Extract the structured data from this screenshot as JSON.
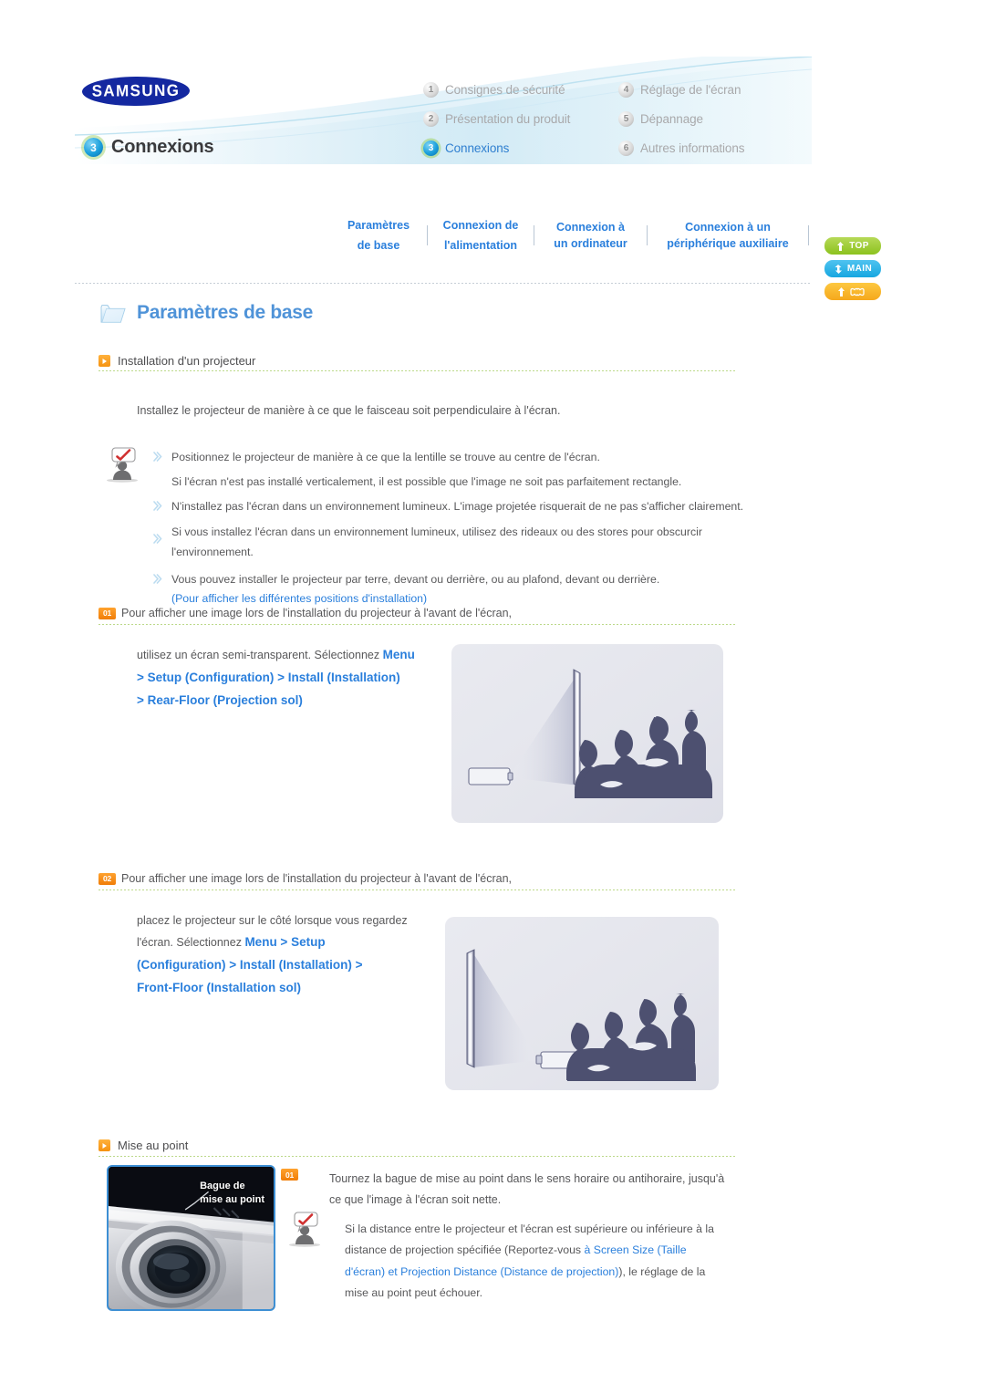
{
  "header": {
    "brand": "SAMSUNG",
    "chapter_number": "3",
    "chapter_name": "Connexions",
    "menu": [
      {
        "num": "1",
        "label": "Consignes de sécurité",
        "active": false
      },
      {
        "num": "4",
        "label": "Réglage de l'écran",
        "active": false
      },
      {
        "num": "2",
        "label": "Présentation du produit",
        "active": false
      },
      {
        "num": "5",
        "label": "Dépannage",
        "active": false
      },
      {
        "num": "3",
        "label": "Connexions",
        "active": true
      },
      {
        "num": "6",
        "label": "Autres informations",
        "active": false
      }
    ]
  },
  "tabs": [
    {
      "line1": "Paramètres",
      "line2": "de base"
    },
    {
      "line1": "Connexion de",
      "line2": "l'alimentation"
    },
    {
      "line1": "Connexion à",
      "line2": "un ordinateur"
    },
    {
      "line1": "Connexion à un",
      "line2": "périphérique auxiliaire"
    }
  ],
  "side_buttons": [
    {
      "label": "TOP",
      "icon": "arrow-up-icon",
      "color": "#8cc21e"
    },
    {
      "label": "MAIN",
      "icon": "arrow-branch-icon",
      "color": "#17a7e0"
    },
    {
      "label": "",
      "icon": "arrow-up-home-icon",
      "color": "#f5a81c"
    }
  ],
  "section": {
    "title": "Paramètres de base",
    "title_icon": "folder-icon"
  },
  "subsection_1": {
    "heading": "Installation d'un projecteur",
    "intro": "Installez le projecteur de manière à ce que le faisceau soit perpendiculaire à l'écran.",
    "tip_icon": "person-note-icon",
    "bullets": [
      {
        "bullet": true,
        "text": "Positionnez le projecteur de manière à ce que la lentille se trouve au centre de l'écran."
      },
      {
        "bullet": false,
        "text": "Si l'écran n'est pas installé verticalement, il est possible que l'image ne soit pas parfaitement rectangle."
      },
      {
        "bullet": true,
        "text": "N'installez pas l'écran dans un environnement lumineux. L'image projetée risquerait de ne pas s'afficher clairement."
      },
      {
        "bullet": true,
        "text": "Si vous installez l'écran dans un environnement lumineux, utilisez des rideaux ou des stores pour obscurcir l'environnement."
      },
      {
        "bullet": true,
        "text": "Vous pouvez installer le projecteur par terre, devant ou derrière, ou au plafond, devant ou derrière."
      }
    ],
    "link": "(Pour afficher les différentes positions d'installation)"
  },
  "step_1": {
    "num": "01",
    "heading": "Pour afficher une image lors de l'installation du projecteur à l'avant de l'écran,",
    "body_plain": "utilisez un écran semi-transparent. Sélectionnez ",
    "body_bold_1": "Menu",
    "body_bold_2": "> Setup (Configuration) > Install (Installation)",
    "body_bold_3": "> Rear-Floor (Projection sol)",
    "illustration": "rear-projection-diagram"
  },
  "step_2": {
    "num": "02",
    "heading": "Pour afficher une image lors de l'installation du projecteur à l'avant de l'écran,",
    "body_plain_1": "placez le projecteur sur le côté lorsque vous regardez",
    "body_plain_2": "l'écran. Sélectionnez ",
    "body_bold_1": "Menu > Setup",
    "body_bold_2": "(Configuration) > Install (Installation) >",
    "body_bold_3": "Front-Floor (Installation sol)",
    "illustration": "front-projection-diagram"
  },
  "subsection_2": {
    "heading": "Mise au point",
    "photo_label_line1": "Bague de",
    "photo_label_line2": "mise au point",
    "step_num": "01",
    "step_text_1": "Tournez la bague de mise au point dans le sens horaire ou antihoraire, jusqu'à",
    "step_text_2": "ce que l'image à l'écran soit nette.",
    "tip_icon": "person-note-icon",
    "tip_text_1": "Si la distance entre le projecteur et l'écran est supérieure ou inférieure à la",
    "tip_text_2": "distance de projection spécifiée (Reportez-vous ",
    "tip_link_1": "à Screen Size (Taille",
    "tip_link_2": "d'écran) et Projection Distance (Distance de projection)",
    "tip_text_3": "), le réglage de la",
    "tip_text_4": "mise au point peut échouer."
  },
  "colors": {
    "accent_blue": "#2a7fdc",
    "title_blue": "#4f93d8",
    "orange": "#f59210",
    "green": "#8cc21e",
    "text_gray": "#58585a"
  }
}
